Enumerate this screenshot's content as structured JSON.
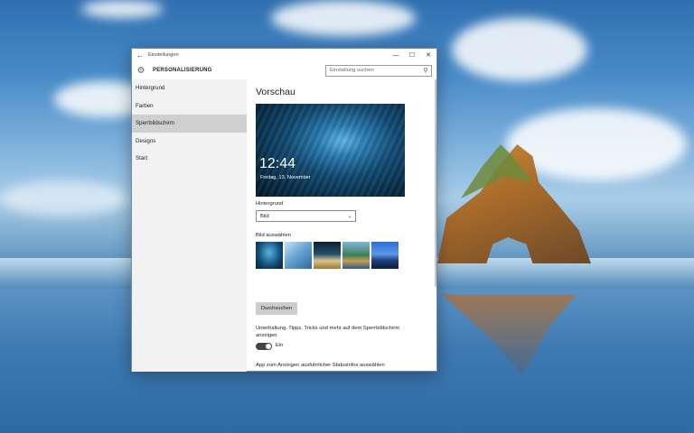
{
  "window": {
    "title": "Einstellungen",
    "back_icon": "arrow-left-icon",
    "controls": {
      "minimize": "—",
      "maximize": "☐",
      "close": "✕"
    }
  },
  "header": {
    "gear_icon": "gear-icon",
    "section": "PERSONALISIERUNG",
    "search_placeholder": "Einstellung suchen",
    "search_icon": "search-icon"
  },
  "sidebar": {
    "items": [
      {
        "label": "Hintergrund",
        "selected": false
      },
      {
        "label": "Farben",
        "selected": false
      },
      {
        "label": "Sperrbildschirm",
        "selected": true
      },
      {
        "label": "Designs",
        "selected": false
      },
      {
        "label": "Start",
        "selected": false
      }
    ]
  },
  "main": {
    "heading": "Vorschau",
    "preview": {
      "time": "12:44",
      "date": "Freitag, 13. November"
    },
    "background_label": "Hintergrund",
    "background_value": "Bild",
    "choose_image_label": "Bild auswählen",
    "browse_label": "Durchsuchen",
    "tips_text": "Unterhaltung, Tipps, Tricks und mehr auf dem Sperrbildschirm anzeigen",
    "toggle_state": "Ein",
    "toggle_on": true,
    "app_status_label": "App zum Anzeigen ausführlicher Statusinfos auswählen"
  }
}
